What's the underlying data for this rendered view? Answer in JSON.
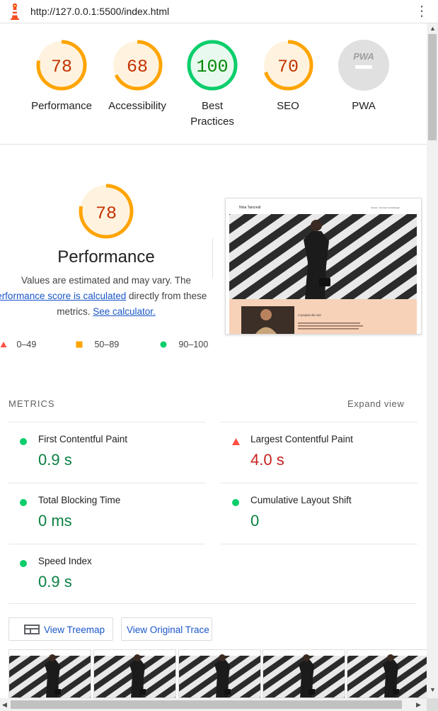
{
  "browser": {
    "url": "http://127.0.0.1:5500/index.html"
  },
  "colors": {
    "average": "#ffa400",
    "average_bg": "#fff3e0",
    "average_text": "#c33300",
    "pass": "#0cce6b",
    "pass_bg": "#e8f9ef",
    "pass_text": "#008800",
    "fail": "#ff4e42",
    "na_bg": "#e0e0e0",
    "link": "#1a56c8"
  },
  "categories": [
    {
      "label": "Performance",
      "score": "78",
      "value": 78,
      "status": "average"
    },
    {
      "label": "Accessibility",
      "score": "68",
      "value": 68,
      "status": "average"
    },
    {
      "label_line1": "Best",
      "label_line2": "Practices",
      "score": "100",
      "value": 100,
      "status": "pass"
    },
    {
      "label": "SEO",
      "score": "70",
      "value": 70,
      "status": "average"
    },
    {
      "label": "PWA",
      "score": "PWA",
      "status": "na"
    }
  ],
  "performance": {
    "score": "78",
    "value": 78,
    "title": "Performance",
    "desc_part1": "Values are estimated and may vary. The",
    "desc_link": "performance score is calculated",
    "desc_part2": "directly from these",
    "desc_part3": "metrics.",
    "calc_link": "See calculator."
  },
  "legend": [
    {
      "shape": "triangle",
      "range": "0–49"
    },
    {
      "shape": "square",
      "range": "50–89"
    },
    {
      "shape": "circle",
      "range": "90–100"
    }
  ],
  "screenshot": {
    "brand": "Nina Tancredi",
    "nav_items": [
      "Accueil",
      "Services",
      "Contact",
      "Login"
    ],
    "about_title": "A propos de moi",
    "about_text": "Photographe profitant de plus d'une dizaine d'années d'expérience dans l'art de la photographie."
  },
  "metrics_section": {
    "heading": "METRICS",
    "expand_label": "Expand view"
  },
  "metrics": [
    {
      "name": "First Contentful Paint",
      "value": "0.9 s",
      "status": "pass"
    },
    {
      "name": "Largest Contentful Paint",
      "value": "4.0 s",
      "status": "fail"
    },
    {
      "name": "Total Blocking Time",
      "value": "0 ms",
      "status": "pass"
    },
    {
      "name": "Cumulative Layout Shift",
      "value": "0",
      "status": "pass"
    },
    {
      "name": "Speed Index",
      "value": "0.9 s",
      "status": "pass"
    }
  ],
  "buttons": {
    "treemap": "View Treemap",
    "trace": "View Original Trace"
  },
  "icons": {
    "logo": "lighthouse-icon",
    "menu": "kebab-menu-icon",
    "treemap": "treemap-icon"
  }
}
